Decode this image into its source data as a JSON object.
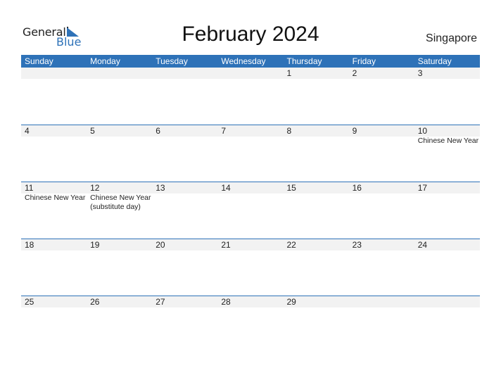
{
  "logo": {
    "general": "General",
    "blue": "Blue"
  },
  "title": "February 2024",
  "country": "Singapore",
  "colors": {
    "accent": "#2e72b8",
    "band": "#f2f2f2"
  },
  "weekdays": [
    "Sunday",
    "Monday",
    "Tuesday",
    "Wednesday",
    "Thursday",
    "Friday",
    "Saturday"
  ],
  "weeks": [
    [
      {
        "day": ""
      },
      {
        "day": ""
      },
      {
        "day": ""
      },
      {
        "day": ""
      },
      {
        "day": "1"
      },
      {
        "day": "2"
      },
      {
        "day": "3"
      }
    ],
    [
      {
        "day": "4"
      },
      {
        "day": "5"
      },
      {
        "day": "6"
      },
      {
        "day": "7"
      },
      {
        "day": "8"
      },
      {
        "day": "9"
      },
      {
        "day": "10",
        "events": [
          "Chinese New Year"
        ]
      }
    ],
    [
      {
        "day": "11",
        "events": [
          "Chinese New Year"
        ]
      },
      {
        "day": "12",
        "events": [
          "Chinese New Year (substitute day)"
        ]
      },
      {
        "day": "13"
      },
      {
        "day": "14"
      },
      {
        "day": "15"
      },
      {
        "day": "16"
      },
      {
        "day": "17"
      }
    ],
    [
      {
        "day": "18"
      },
      {
        "day": "19"
      },
      {
        "day": "20"
      },
      {
        "day": "21"
      },
      {
        "day": "22"
      },
      {
        "day": "23"
      },
      {
        "day": "24"
      }
    ],
    [
      {
        "day": "25"
      },
      {
        "day": "26"
      },
      {
        "day": "27"
      },
      {
        "day": "28"
      },
      {
        "day": "29"
      },
      {
        "day": ""
      },
      {
        "day": ""
      }
    ]
  ]
}
